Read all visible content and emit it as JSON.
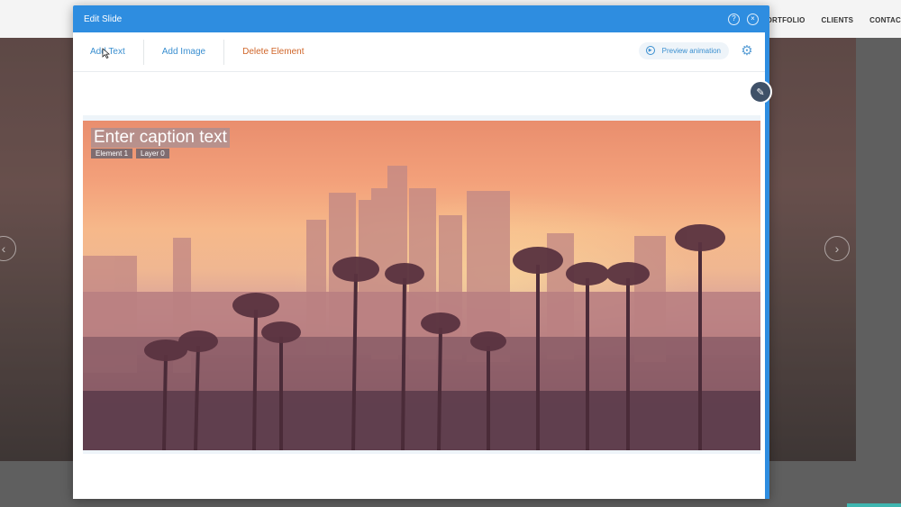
{
  "background_site": {
    "nav": [
      "PORTFOLIO",
      "CLIENTS",
      "CONTAC"
    ],
    "arrow_left": "‹",
    "arrow_right": "›"
  },
  "modal": {
    "title": "Edit Slide",
    "header_icons": [
      "help-icon",
      "close-icon"
    ],
    "toolbar": {
      "add_text": "Add Text",
      "add_image": "Add Image",
      "delete_element": "Delete Element",
      "preview_animation": "Preview animation",
      "settings_icon": "gear-icon"
    },
    "canvas": {
      "caption": "Enter caption text",
      "element_tag": "Element 1",
      "layer_tag": "Layer 0"
    }
  },
  "colors": {
    "header_blue": "#2e8de0",
    "link_blue": "#3a8fd0",
    "danger_orange": "#d0662a"
  }
}
